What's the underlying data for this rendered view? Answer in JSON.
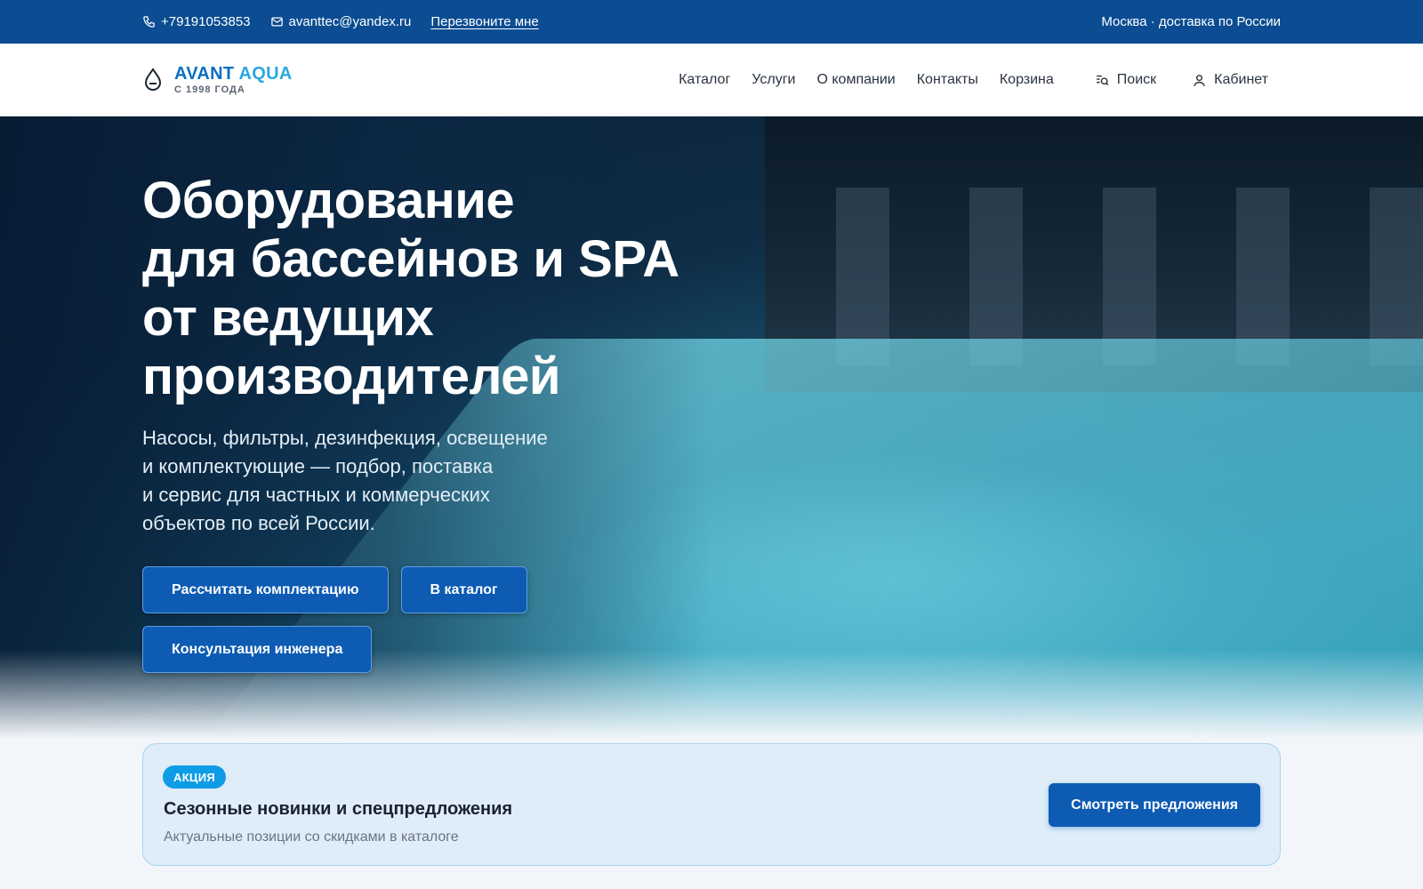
{
  "topbar": {
    "phone": "+79191053853",
    "email": "avanttec@yandex.ru",
    "callback": "Перезвоните мне",
    "delivery": "Москва · доставка по России"
  },
  "header": {
    "logo_name_1": "AVANT",
    "logo_name_2": "AQUA",
    "logo_sub": "С 1998 ГОДА",
    "nav": [
      "Каталог",
      "Услуги",
      "О компании",
      "Контакты",
      "Корзина"
    ],
    "search": "Поиск",
    "cabinet": "Кабинет"
  },
  "hero": {
    "title_lines": [
      "Оборудование",
      "для бассейнов и SPA",
      "от ведущих",
      "производителей"
    ],
    "subtitle_lines": [
      "Насосы, фильтры, дезинфекция, освещение",
      "и комплектующие — подбор, поставка",
      "и сервис для частных и коммерческих",
      "объектов по всей России."
    ],
    "btn_calc": "Рассчитать комплектацию",
    "btn_catalog": "В каталог",
    "btn_consult": "Консультация инженера"
  },
  "promo": {
    "badge": "АКЦИЯ",
    "title": "Сезонные новинки и спецпредложения",
    "subtitle": "Актуальные позиции со скидками в каталоге",
    "button": "Смотреть предложения"
  },
  "colors": {
    "topbar": "#0b4c92",
    "accent": "#0d5bb3",
    "badge": "#0f9ce6",
    "logo": "#0b6fc2"
  }
}
